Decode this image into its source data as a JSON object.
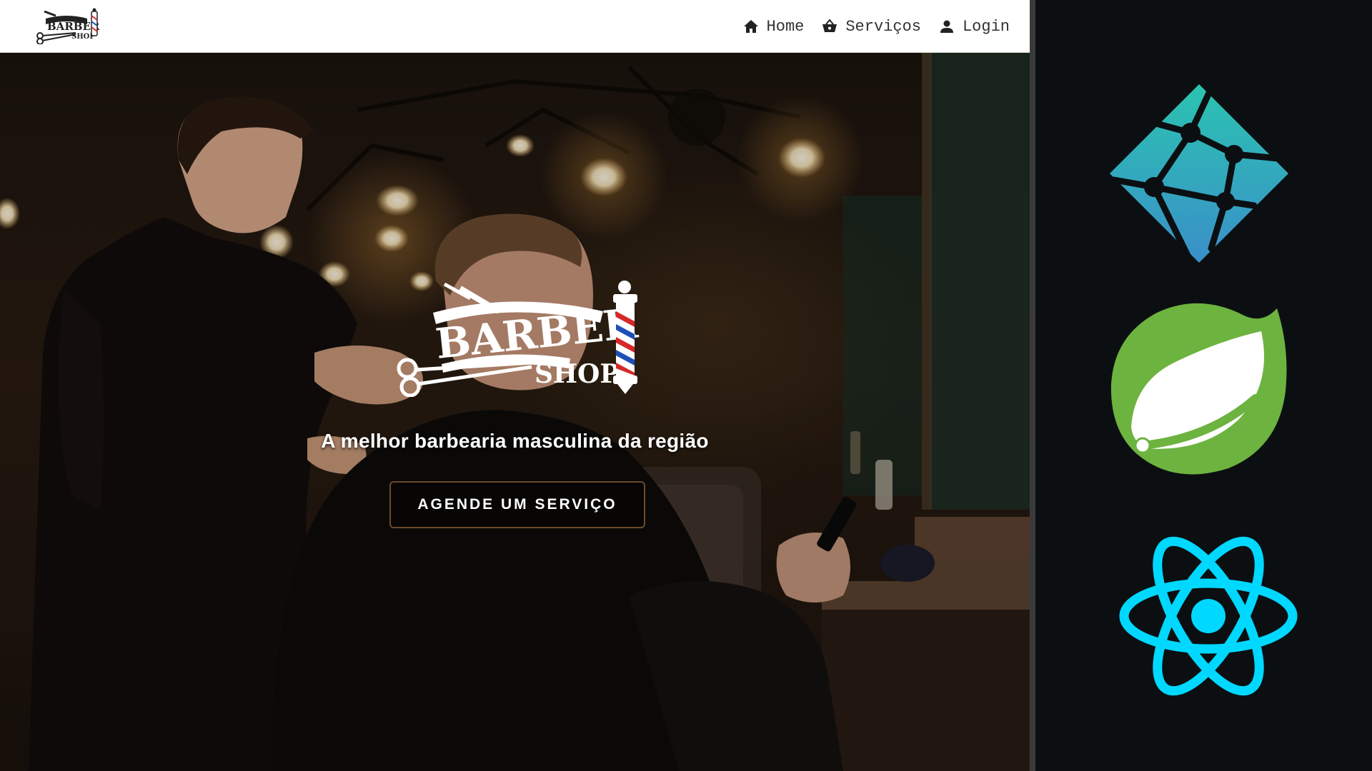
{
  "navbar": {
    "logo_icon": "barber-shop-logo",
    "links": [
      {
        "label": "Home",
        "icon": "home-icon"
      },
      {
        "label": "Serviços",
        "icon": "basket-icon"
      },
      {
        "label": "Login",
        "icon": "user-icon"
      }
    ]
  },
  "hero": {
    "logo_line1": "BARBER",
    "logo_line2": "SHOP",
    "tagline": "A melhor barbearia masculina da região",
    "cta_label": "AGENDE UM SERVIÇO"
  },
  "tech_logos": [
    {
      "icon": "netlify-icon"
    },
    {
      "icon": "spring-icon"
    },
    {
      "icon": "react-icon"
    }
  ],
  "colors": {
    "panel_background": "#0b0f12",
    "navbar_background": "#ffffff",
    "cta_border": "#6b4a2a",
    "netlify_teal": "#2bb9b3",
    "spring_green": "#6db33f",
    "react_cyan": "#00d8ff",
    "pole_red": "#d62828",
    "pole_blue": "#1d4fb8"
  }
}
